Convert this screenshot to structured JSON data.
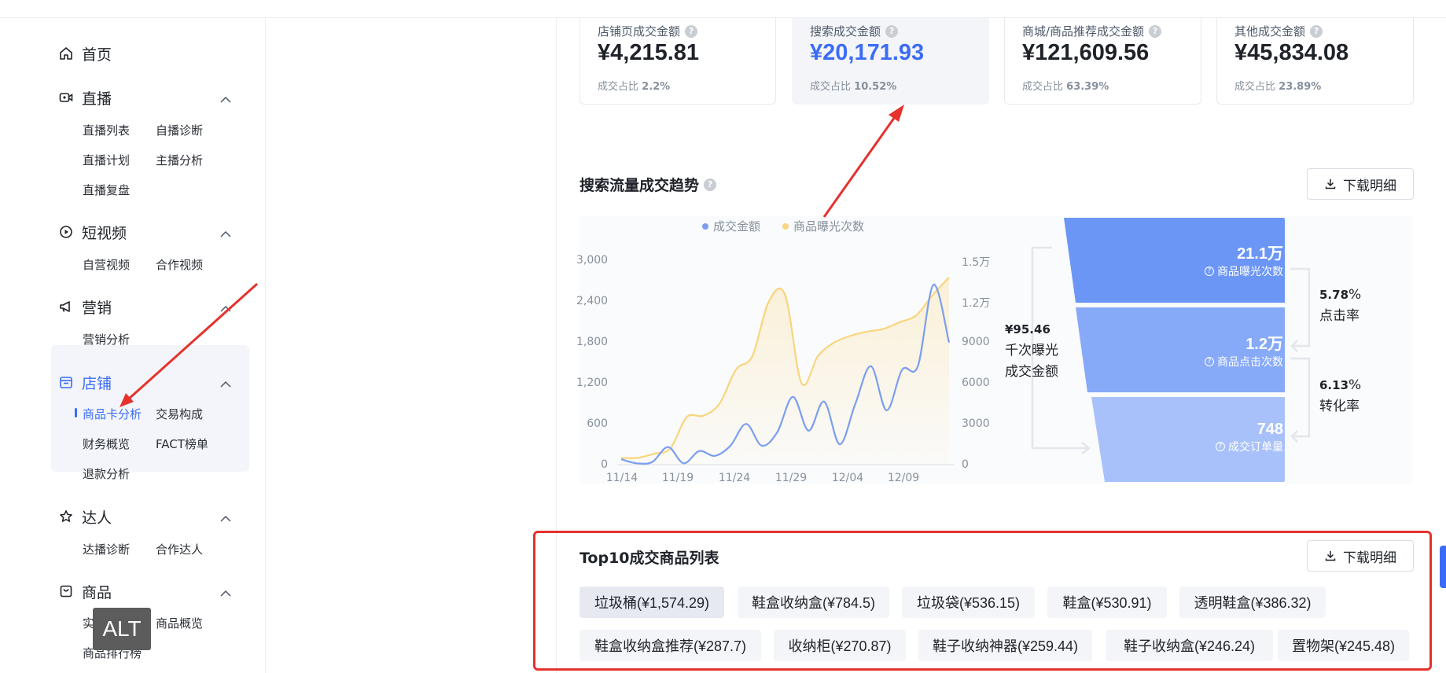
{
  "sidebar": {
    "home": "首页",
    "sections": [
      {
        "label": "直播",
        "icon": "live-icon",
        "items": [
          "直播列表",
          "自播诊断",
          "直播计划",
          "主播分析",
          "直播复盘"
        ]
      },
      {
        "label": "短视频",
        "icon": "video-icon",
        "items": [
          "自营视频",
          "合作视频"
        ]
      },
      {
        "label": "营销",
        "icon": "megaphone-icon",
        "items": [
          "营销分析"
        ]
      },
      {
        "label": "店铺",
        "icon": "store-icon",
        "items": [
          "商品卡分析",
          "交易构成",
          "财务概览",
          "FACT榜单",
          "退款分析"
        ]
      },
      {
        "label": "达人",
        "icon": "star-icon",
        "items": [
          "达播诊断",
          "合作达人"
        ]
      },
      {
        "label": "商品",
        "icon": "product-icon",
        "items": [
          "实时商品",
          "商品概览",
          "商品排行榜"
        ]
      }
    ],
    "active_item": "商品卡分析"
  },
  "alt_badge": "ALT",
  "metrics": [
    {
      "label": "店铺页成交金额",
      "value": "¥4,215.81",
      "ratio_label": "成交占比",
      "ratio": "2.2%"
    },
    {
      "label": "搜索成交金额",
      "value": "¥20,171.93",
      "ratio_label": "成交占比",
      "ratio": "10.52%"
    },
    {
      "label": "商城/商品推荐成交金额",
      "value": "¥121,609.56",
      "ratio_label": "成交占比",
      "ratio": "63.39%"
    },
    {
      "label": "其他成交金额",
      "value": "¥45,834.08",
      "ratio_label": "成交占比",
      "ratio": "23.89%"
    }
  ],
  "trend": {
    "title": "搜索流量成交趋势",
    "download": "下载明细"
  },
  "chart_data": {
    "type": "line",
    "x": [
      "11/14",
      "11/15",
      "11/16",
      "11/17",
      "11/18",
      "11/19",
      "11/20",
      "11/21",
      "11/22",
      "11/23",
      "11/24",
      "11/25",
      "11/26",
      "11/27",
      "11/28",
      "11/29",
      "11/30",
      "12/01",
      "12/02",
      "12/03",
      "12/04",
      "12/05",
      "12/06",
      "12/07",
      "12/08",
      "12/09",
      "12/10",
      "12/11",
      "12/12"
    ],
    "x_tick_labels": [
      "11/14",
      "11/19",
      "11/24",
      "11/29",
      "12/04",
      "12/09"
    ],
    "series": [
      {
        "name": "成交金额",
        "axis": "left",
        "color": "#7b9ef0",
        "values": [
          80,
          20,
          40,
          260,
          20,
          200,
          130,
          280,
          600,
          280,
          480,
          1000,
          500,
          930,
          300,
          900,
          1450,
          800,
          1400,
          1450,
          2650,
          1800
        ]
      },
      {
        "name": "商品曝光次数",
        "axis": "right",
        "color": "#f8d57e",
        "values": [
          500,
          500,
          800,
          1200,
          3500,
          3600,
          4500,
          7000,
          8000,
          12000,
          12500,
          6000,
          8000,
          9000,
          9500,
          9800,
          10000,
          10500,
          11000,
          12500,
          13800
        ]
      }
    ],
    "y_left": {
      "ticks": [
        "0",
        "600",
        "1,200",
        "1,800",
        "2,400",
        "3,000"
      ],
      "min": 0,
      "max": 3000
    },
    "y_right": {
      "ticks": [
        "0",
        "3000",
        "6000",
        "9000",
        "1.2万",
        "1.5万"
      ],
      "min": 0,
      "max": 15000
    },
    "legend": "top-center",
    "grid": false
  },
  "funnel": {
    "stages": [
      {
        "value": "21.1万",
        "label": "商品曝光次数"
      },
      {
        "value": "1.2万",
        "label": "商品点击次数"
      },
      {
        "value": "748",
        "label": "成交订单量"
      }
    ],
    "left_value": "¥95.46",
    "left_label_1": "千次曝光",
    "left_label_2": "成交金额",
    "rates": [
      {
        "pct": "5.78",
        "unit": "%",
        "label": "点击率"
      },
      {
        "pct": "6.13",
        "unit": "%",
        "label": "转化率"
      }
    ],
    "colors": [
      "#6b96f6",
      "#86a9f8",
      "#a8c1fa"
    ]
  },
  "top10": {
    "title": "Top10成交商品列表",
    "download": "下载明细",
    "items": [
      "垃圾桶(¥1,574.29)",
      "鞋盒收纳盒(¥784.5)",
      "垃圾袋(¥536.15)",
      "鞋盒(¥530.91)",
      "透明鞋盒(¥386.32)",
      "鞋盒收纳盒推荐(¥287.7)",
      "收纳柜(¥270.87)",
      "鞋子收纳神器(¥259.44)",
      "鞋子收纳盒(¥246.24)",
      "置物架(¥245.48)"
    ]
  }
}
